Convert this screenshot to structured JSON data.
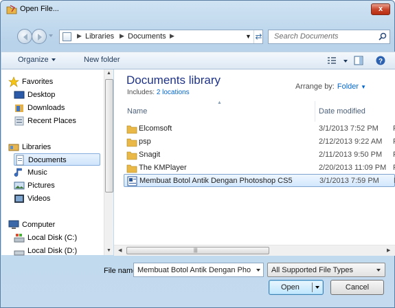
{
  "window": {
    "title": "Open File...",
    "close_label": "x"
  },
  "address": {
    "crumbs": [
      "Libraries",
      "Documents"
    ],
    "search_placeholder": "Search Documents"
  },
  "toolbar": {
    "organize": "Organize",
    "new_folder": "New folder"
  },
  "nav": {
    "favorites": "Favorites",
    "desktop": "Desktop",
    "downloads": "Downloads",
    "recent": "Recent Places",
    "libraries": "Libraries",
    "documents": "Documents",
    "music": "Music",
    "pictures": "Pictures",
    "videos": "Videos",
    "computer": "Computer",
    "disk_c": "Local Disk (C:)",
    "disk_d": "Local Disk (D:)"
  },
  "library": {
    "title": "Documents library",
    "includes_label": "Includes:",
    "includes_link": "2 locations",
    "arrange_label": "Arrange by:",
    "arrange_value": "Folder"
  },
  "columns": {
    "name": "Name",
    "date": "Date modified"
  },
  "files": [
    {
      "name": "Elcomsoft",
      "date": "3/1/2013 7:52 PM",
      "type": "F",
      "kind": "folder"
    },
    {
      "name": "psp",
      "date": "2/12/2013 9:22 AM",
      "type": "F",
      "kind": "folder"
    },
    {
      "name": "Snagit",
      "date": "2/11/2013 9:50 PM",
      "type": "F",
      "kind": "folder"
    },
    {
      "name": "The KMPlayer",
      "date": "2/20/2013 11:09 PM",
      "type": "F",
      "kind": "folder"
    },
    {
      "name": "Membuat Botol Antik Dengan Photoshop CS5",
      "date": "3/1/2013 7:59 PM",
      "type": "M",
      "kind": "document"
    }
  ],
  "bottom": {
    "file_name_label": "File name:",
    "file_name_value": "Membuat Botol Antik Dengan Pho",
    "file_type": "All Supported File Types",
    "open": "Open",
    "cancel": "Cancel"
  }
}
